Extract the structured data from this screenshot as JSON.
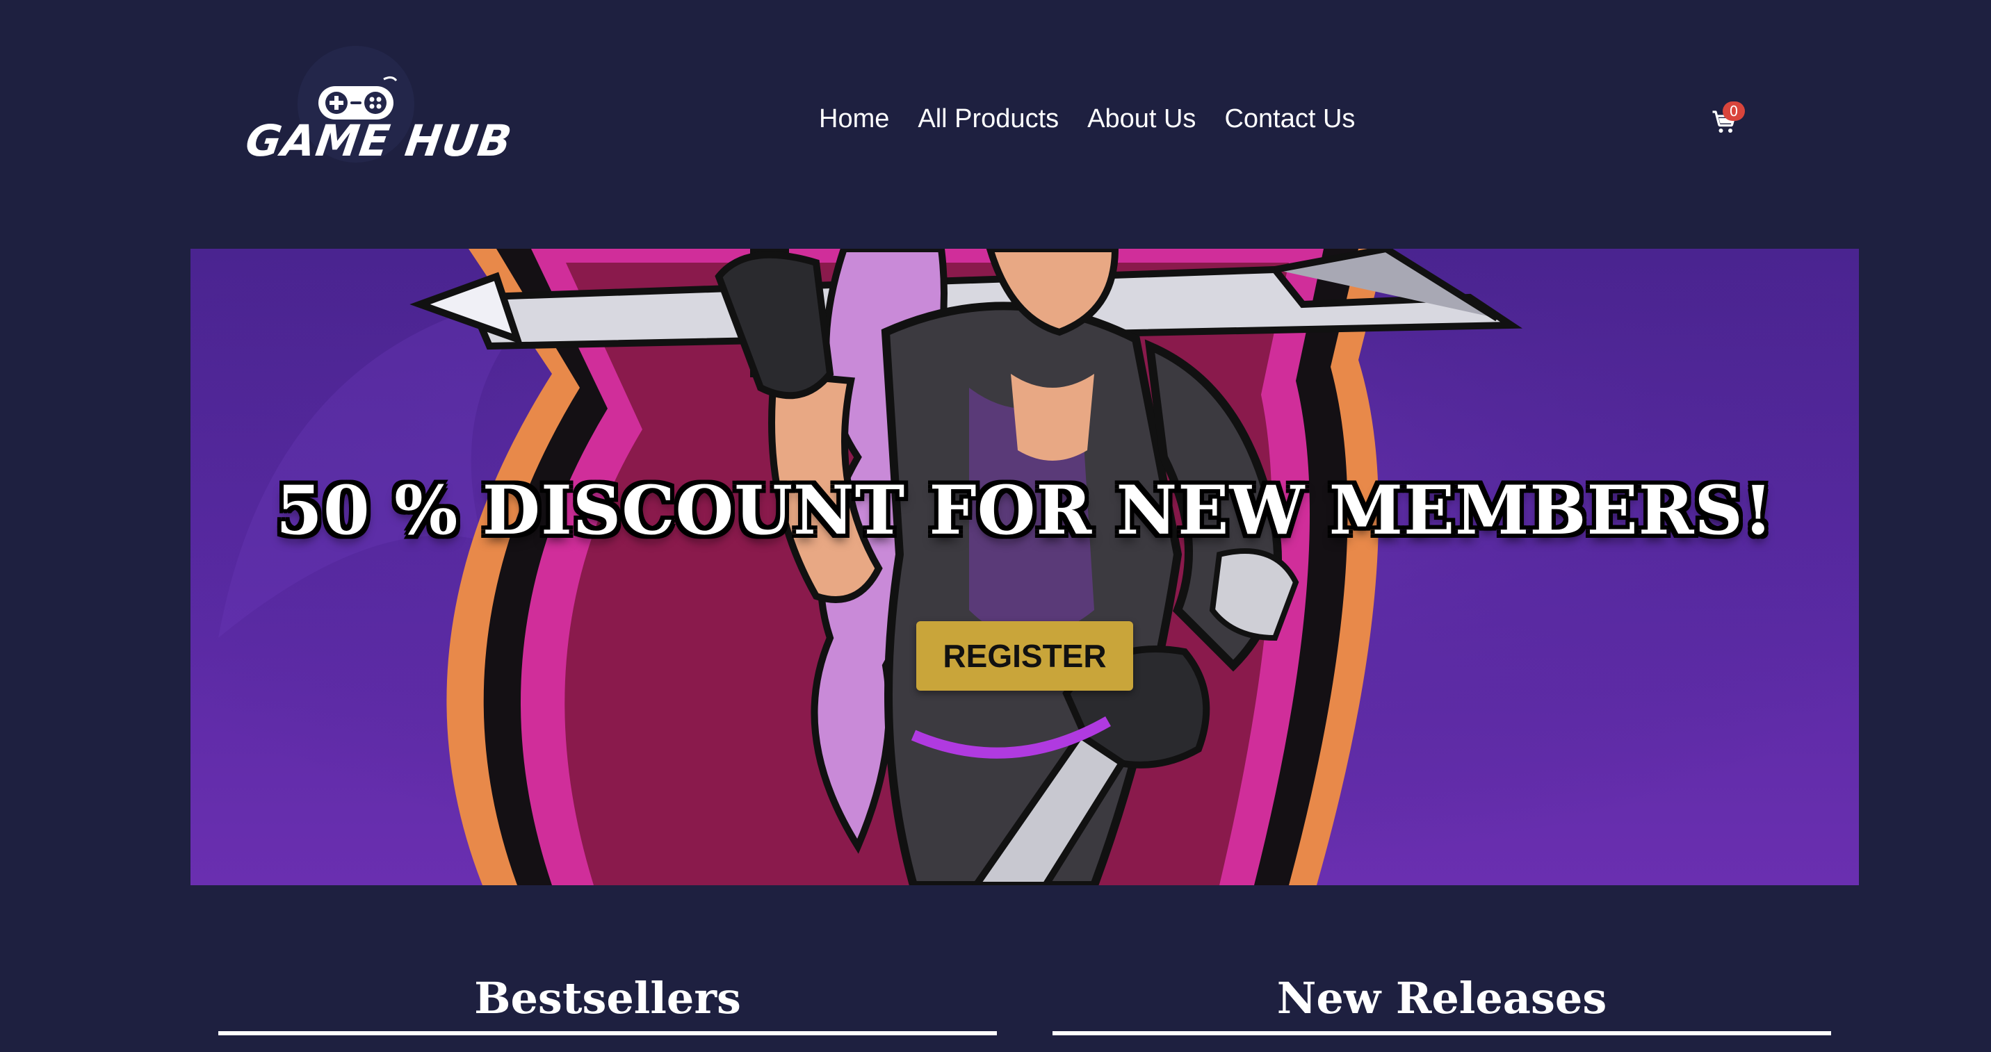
{
  "brand": {
    "name": "GAME HUB",
    "logo_icon": "gamepad-icon"
  },
  "nav": {
    "items": [
      {
        "label": "Home"
      },
      {
        "label": "All Products"
      },
      {
        "label": "About Us"
      },
      {
        "label": "Contact Us"
      }
    ]
  },
  "cart": {
    "icon": "shopping-cart-icon",
    "count": "0"
  },
  "hero": {
    "headline": "50 % DISCOUNT FOR NEW MEMBERS!",
    "cta_label": "REGISTER"
  },
  "sections": {
    "bestsellers_title": "Bestsellers",
    "new_releases_title": "New Releases"
  },
  "colors": {
    "page_background": "#1e2040",
    "cta_background": "#c9a53a",
    "badge": "#d9453c",
    "hero_purple": "#5a2aa4",
    "hero_magenta": "#c2187a",
    "hero_orange": "#e8894a"
  }
}
